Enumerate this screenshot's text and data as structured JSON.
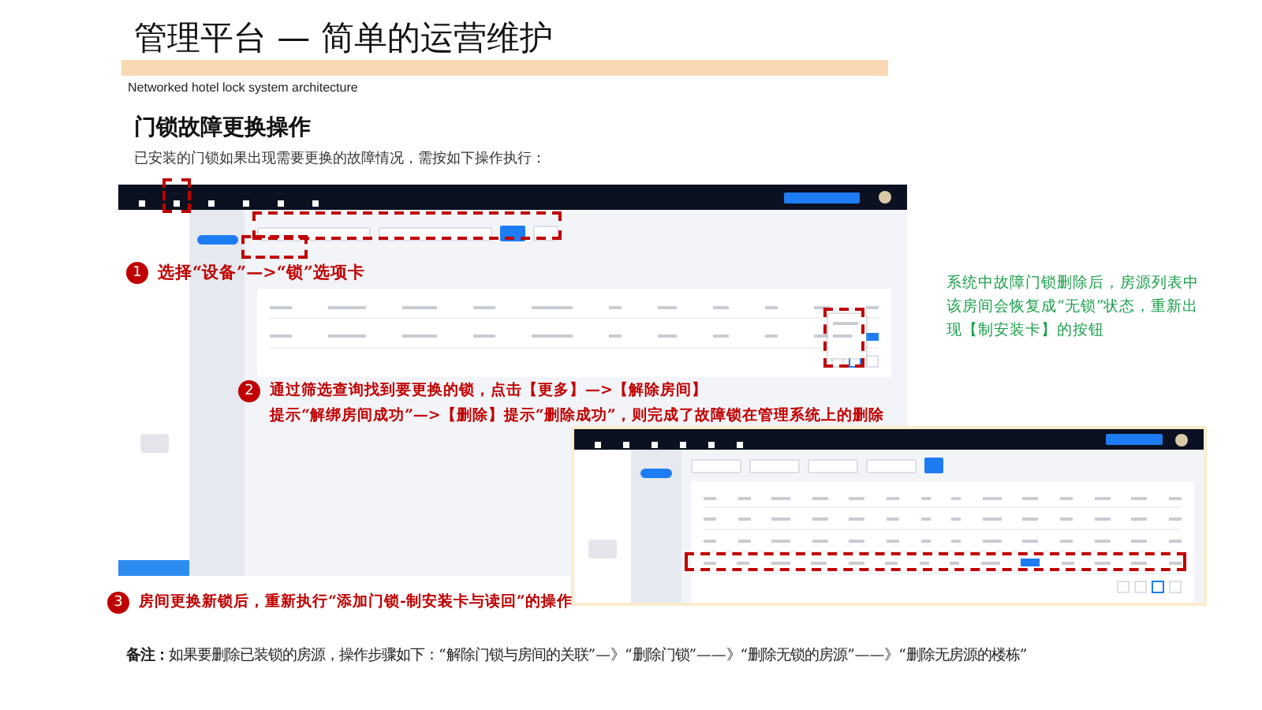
{
  "title": "管理平台 — 简单的运营维护",
  "subtitle": "Networked hotel lock system architecture",
  "heading": "门锁故障更换操作",
  "intro": "已安装的门锁如果出现需要更换的故障情况，需按如下操作执行：",
  "steps": [
    {
      "number": "1",
      "lines": [
        "选择“设备”—>“锁”选项卡"
      ]
    },
    {
      "number": "2",
      "lines": [
        "通过筛选查询找到要更换的锁，点击【更多】—>【解除房间】",
        "提示“解绑房间成功”—>【删除】提示“删除成功”，则完成了故障锁在管理系统上的删除"
      ]
    },
    {
      "number": "3",
      "lines": [
        "房间更换新锁后，重新执行“添加门锁-制安装卡与读回”的操作"
      ]
    }
  ],
  "side_note": "系统中故障门锁删除后，房源列表中该房间会恢复成“无锁”状态，重新出现【制安装卡】的按钮",
  "footnote": "**备注：**如果要删除已装锁的房源，操作步骤如下：“解除门锁与房间的关联”—》“删除门锁”——》“删除无锁的房源”——》“删除无房源的楼栋”"
}
